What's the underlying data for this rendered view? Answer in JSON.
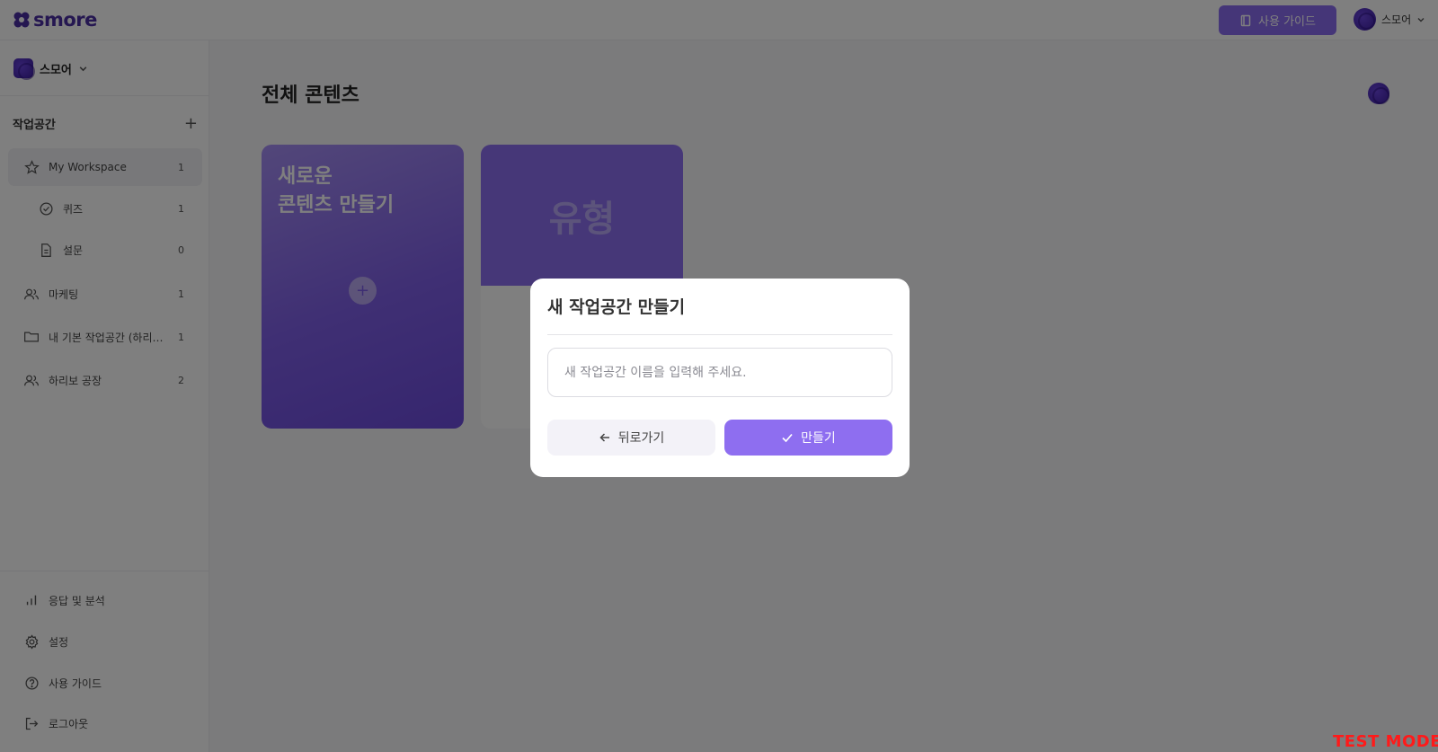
{
  "header": {
    "logo_text": "smore",
    "guide_button_label": "사용 가이드",
    "user_name": "스모어"
  },
  "sidebar": {
    "org_name": "스모어",
    "workspace_heading": "작업공간",
    "items": [
      {
        "label": "My Workspace",
        "count": "1",
        "icon": "star-icon"
      },
      {
        "label": "퀴즈",
        "count": "1",
        "icon": "check-circle-icon"
      },
      {
        "label": "설문",
        "count": "0",
        "icon": "document-icon"
      },
      {
        "label": "마케팅",
        "count": "1",
        "icon": "users-icon"
      },
      {
        "label": "내 기본 작업공간 (하리보'…",
        "count": "1",
        "icon": "folder-icon"
      },
      {
        "label": "하리보 공장",
        "count": "2",
        "icon": "users-icon"
      }
    ],
    "bottom_items": [
      {
        "label": "응답 및 분석",
        "icon": "bar-chart-icon"
      },
      {
        "label": "설정",
        "icon": "gear-icon"
      },
      {
        "label": "사용 가이드",
        "icon": "help-circle-icon"
      },
      {
        "label": "로그아웃",
        "icon": "logout-icon"
      }
    ]
  },
  "main": {
    "title": "전체 콘텐츠",
    "new_card_line1": "새로운",
    "new_card_line2": "콘텐츠 만들기",
    "type_card_label": "유형"
  },
  "modal": {
    "title": "새 작업공간 만들기",
    "input_value": "",
    "input_placeholder": "새 작업공간 이름을 입력해 주세요.",
    "back_label": "뒤로가기",
    "create_label": "만들기"
  },
  "watermark": "TEST MODE",
  "colors": {
    "accent": "#8e6ef0",
    "brand": "#4b2fa3",
    "watermark": "#ff1a1a"
  }
}
